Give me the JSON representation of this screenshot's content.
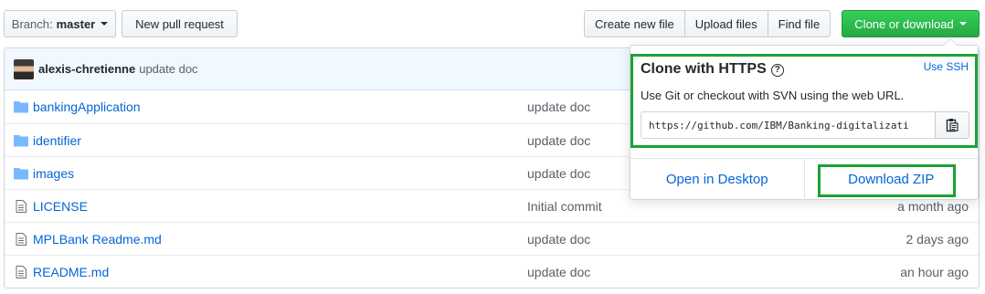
{
  "toolbar": {
    "branch_label": "Branch:",
    "branch_value": "master",
    "new_pr_label": "New pull request",
    "create_file_label": "Create new file",
    "upload_files_label": "Upload files",
    "find_file_label": "Find file",
    "clone_label": "Clone or download"
  },
  "commit": {
    "author": "alexis-chretienne",
    "message": "update doc"
  },
  "files": [
    {
      "name": "bankingApplication",
      "type": "folder",
      "message": "update doc",
      "age": ""
    },
    {
      "name": "identifier",
      "type": "folder",
      "message": "update doc",
      "age": ""
    },
    {
      "name": "images",
      "type": "folder",
      "message": "update doc",
      "age": ""
    },
    {
      "name": "LICENSE",
      "type": "file",
      "message": "Initial commit",
      "age": "a month ago"
    },
    {
      "name": "MPLBank Readme.md",
      "type": "file",
      "message": "update doc",
      "age": "2 days ago"
    },
    {
      "name": "README.md",
      "type": "file",
      "message": "update doc",
      "age": "an hour ago"
    }
  ],
  "clone_popover": {
    "title": "Clone with HTTPS",
    "help_icon": "?",
    "use_ssh": "Use SSH",
    "description": "Use Git or checkout with SVN using the web URL.",
    "url": "https://github.com/IBM/Banking-digitalizati",
    "open_desktop": "Open in Desktop",
    "download_zip": "Download ZIP"
  },
  "colors": {
    "link": "#0366d6",
    "clone_green": "#28a745",
    "highlight_green": "#1aa236"
  },
  "icons": {
    "folder": "folder-icon",
    "file": "file-icon",
    "clipboard": "clipboard-icon",
    "help": "question-icon"
  }
}
